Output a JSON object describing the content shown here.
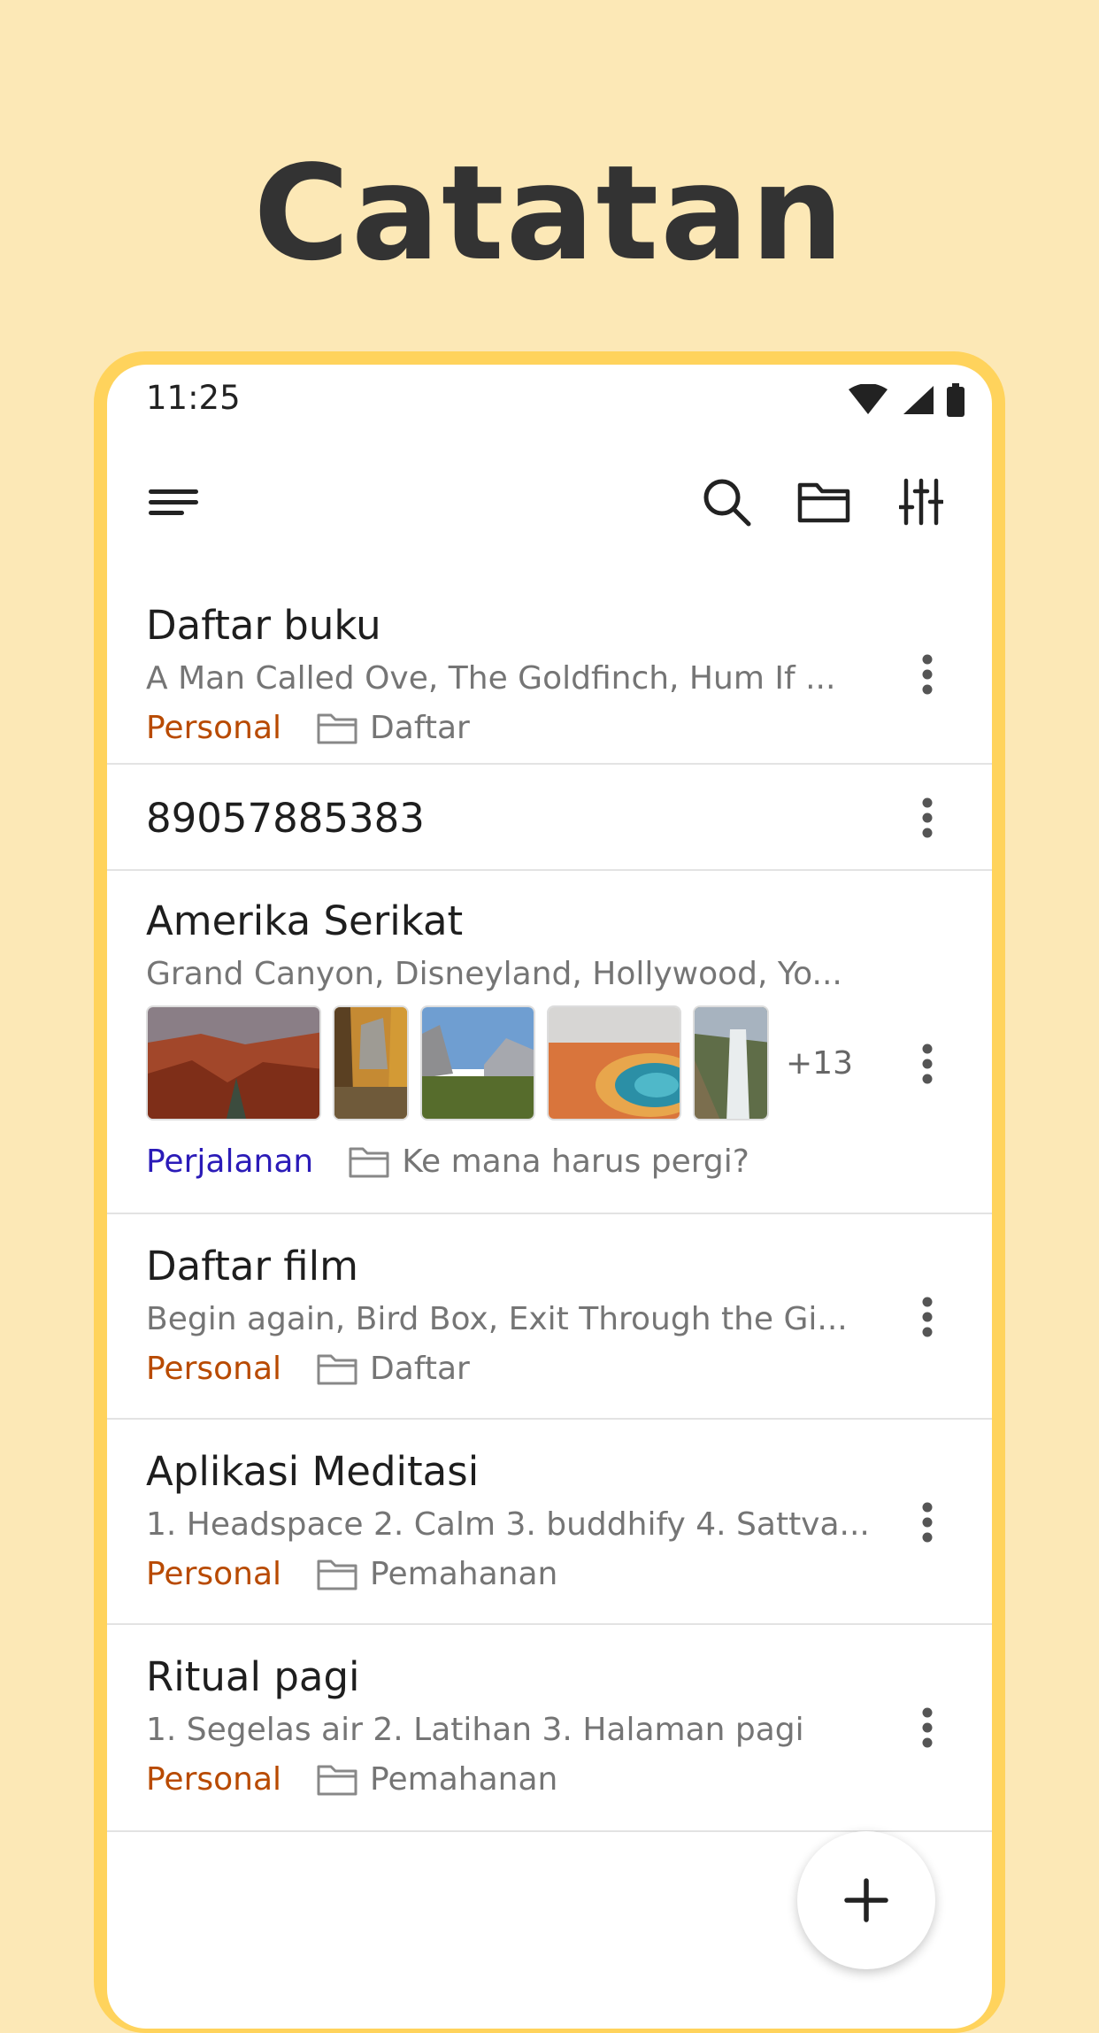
{
  "headline": "Catatan",
  "status_bar": {
    "time": "11:25"
  },
  "toolbar": {
    "icons": [
      "menu-icon",
      "search-icon",
      "folder-icon",
      "sliders-icon"
    ]
  },
  "notes": [
    {
      "title": "Daftar buku",
      "preview": "A Man Called Ove, The Goldfinch, Hum If ...",
      "label": "Personal",
      "label_color": "#B84A00",
      "folder": "Daftar"
    },
    {
      "title": "89057885383"
    },
    {
      "title": "Amerika Serikat",
      "preview": "Grand Canyon, Disneyland, Hollywood, Yo...",
      "images": [
        "grand-canyon",
        "yosemite-autumn",
        "yosemite-valley",
        "grand-prismatic-spring",
        "yellowstone-falls"
      ],
      "more_images": "+13",
      "label": "Perjalanan",
      "label_color": "#2B1BB8",
      "folder": "Ke mana harus pergi?"
    },
    {
      "title": "Daftar film",
      "preview": "Begin again, Bird Box, Exit Through the Gi...",
      "label": "Personal",
      "label_color": "#B84A00",
      "folder": "Daftar"
    },
    {
      "title": "Aplikasi Meditasi",
      "preview": "1. Headspace 2. Calm 3. buddhify 4. Sattva...",
      "label": "Personal",
      "label_color": "#B84A00",
      "folder": "Pemahanan"
    },
    {
      "title": "Ritual pagi",
      "preview": "1. Segelas air 2. Latihan 3. Halaman pagi",
      "label": "Personal",
      "label_color": "#B84A00",
      "folder": "Pemahanan"
    }
  ],
  "colors": {
    "background": "#FCE8B6",
    "frame": "#FFD35C",
    "personal_label": "#B84A00",
    "travel_label": "#2B1BB8"
  }
}
